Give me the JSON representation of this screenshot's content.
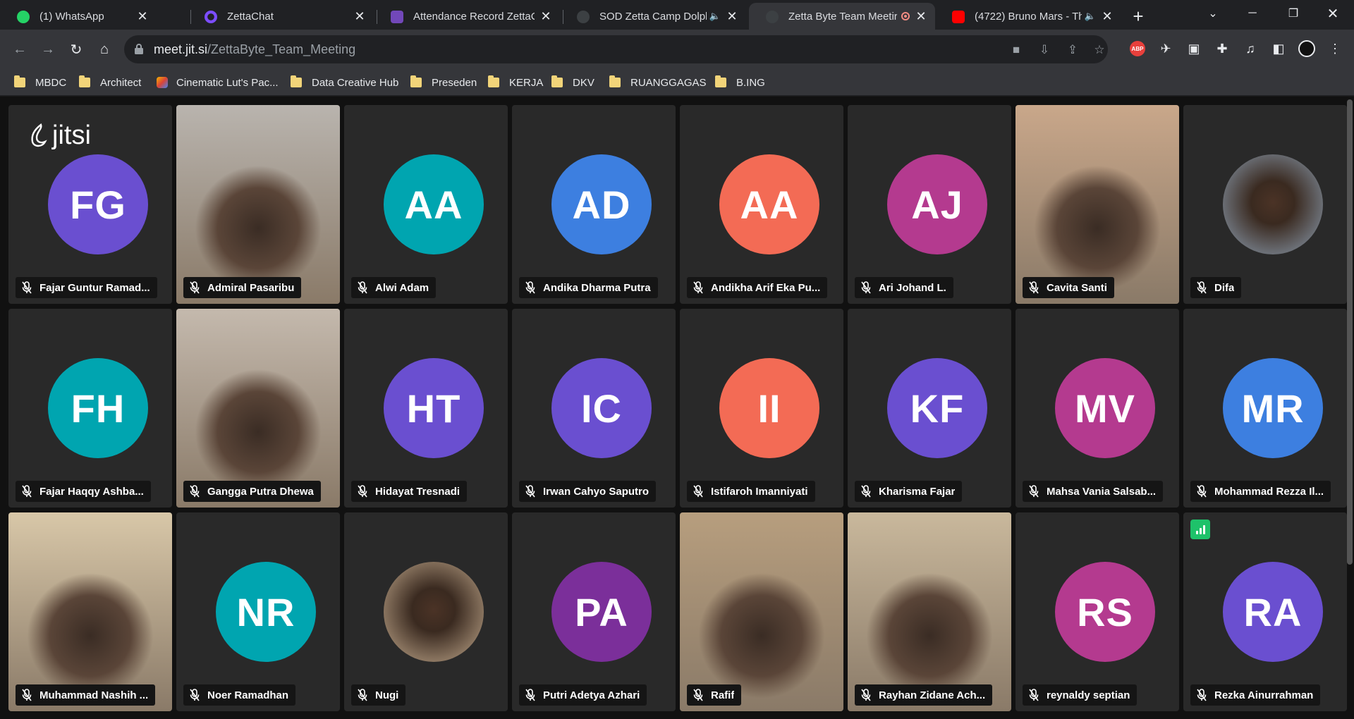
{
  "tabs": [
    {
      "title": "(1) WhatsApp",
      "icon": "whatsapp-icon",
      "color": "#25d366"
    },
    {
      "title": "ZettaChat",
      "icon": "zettachat-icon",
      "color": "#7c4dff"
    },
    {
      "title": "Attendance Record ZettaCa",
      "icon": "google-forms-icon",
      "color": "#7248b9"
    },
    {
      "title": "SOD Zetta Camp Dolph",
      "icon": "jitsi-icon",
      "color": "#3c4043"
    },
    {
      "title": "Zetta Byte Team Meetir",
      "icon": "jitsi-icon",
      "color": "#3c4043"
    },
    {
      "title": "(4722) Bruno Mars - Th",
      "icon": "youtube-icon",
      "color": "#ff0000"
    }
  ],
  "browser": {
    "url_host": "meet.jit.si",
    "url_path": "/ZettaByte_Team_Meeting",
    "abp_label": "ABP"
  },
  "bookmarks": [
    "MBDC",
    "Architect",
    "Cinematic Lut's Pac...",
    "Data Creative Hub",
    "Preseden",
    "KERJA",
    "DKV",
    "RUANGGAGAS",
    "B.ING"
  ],
  "meeting": {
    "logo_text": "jitsi",
    "participants": [
      {
        "name": "Fajar Guntur Ramad...",
        "initials": "FG",
        "color": "#6a4fd0",
        "type": "avatar"
      },
      {
        "name": "Admiral Pasaribu",
        "initials": "",
        "color": "#b9b4ae",
        "type": "video"
      },
      {
        "name": "Alwi Adam",
        "initials": "AA",
        "color": "#00a5b0",
        "type": "avatar"
      },
      {
        "name": "Andika Dharma Putra",
        "initials": "AD",
        "color": "#3d7fe0",
        "type": "avatar"
      },
      {
        "name": "Andikha Arif Eka Pu...",
        "initials": "AA",
        "color": "#f36b55",
        "type": "avatar"
      },
      {
        "name": "Ari Johand L.",
        "initials": "AJ",
        "color": "#b43a8f",
        "type": "avatar"
      },
      {
        "name": "Cavita Santi",
        "initials": "",
        "color": "#c9a78a",
        "type": "video"
      },
      {
        "name": "Difa",
        "initials": "",
        "color": "#6b6f76",
        "type": "photo"
      },
      {
        "name": "Fajar Haqqy Ashba...",
        "initials": "FH",
        "color": "#00a5b0",
        "type": "avatar"
      },
      {
        "name": "Gangga Putra Dhewa",
        "initials": "",
        "color": "#c4b9ad",
        "type": "video"
      },
      {
        "name": "Hidayat Tresnadi",
        "initials": "HT",
        "color": "#6a4fd0",
        "type": "avatar"
      },
      {
        "name": "Irwan Cahyo Saputro",
        "initials": "IC",
        "color": "#6a4fd0",
        "type": "avatar"
      },
      {
        "name": "Istifaroh Imanniyati",
        "initials": "II",
        "color": "#f36b55",
        "type": "avatar"
      },
      {
        "name": "Kharisma Fajar",
        "initials": "KF",
        "color": "#6a4fd0",
        "type": "avatar"
      },
      {
        "name": "Mahsa Vania Salsab...",
        "initials": "MV",
        "color": "#b43a8f",
        "type": "avatar"
      },
      {
        "name": "Mohammad Rezza Il...",
        "initials": "MR",
        "color": "#3d7fe0",
        "type": "avatar"
      },
      {
        "name": "Muhammad Nashih ...",
        "initials": "",
        "color": "#d8c7a8",
        "type": "video"
      },
      {
        "name": "Noer Ramadhan",
        "initials": "NR",
        "color": "#00a5b0",
        "type": "avatar"
      },
      {
        "name": "Nugi",
        "initials": "",
        "color": "#8a7560",
        "type": "photo"
      },
      {
        "name": "Putri Adetya Azhari",
        "initials": "PA",
        "color": "#7b2f9a",
        "type": "avatar"
      },
      {
        "name": "Rafif",
        "initials": "",
        "color": "#b79e7e",
        "type": "video"
      },
      {
        "name": "Rayhan Zidane Ach...",
        "initials": "",
        "color": "#c9b89c",
        "type": "video"
      },
      {
        "name": "reynaldy septian",
        "initials": "RS",
        "color": "#b43a8f",
        "type": "avatar"
      },
      {
        "name": "Rezka Ainurrahman",
        "initials": "RA",
        "color": "#6a4fd0",
        "type": "avatar"
      }
    ]
  }
}
